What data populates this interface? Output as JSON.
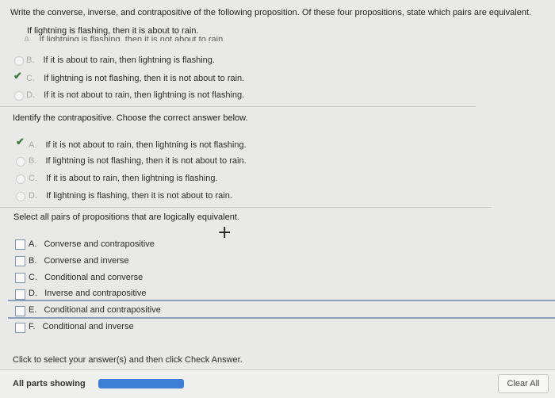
{
  "question": "Write the converse, inverse, and contrapositive of the following proposition. Of these four propositions, state which pairs are equivalent.",
  "proposition": "If lightning is flashing, then it is about to rain.",
  "part1": {
    "cut_option": {
      "letter": "A.",
      "text": "If lightning is flashing, then it is not about to rain."
    },
    "options": [
      {
        "letter": "B.",
        "text": "If it is about to rain, then lightning is flashing."
      },
      {
        "letter": "C.",
        "text": "If lightning is not flashing, then it is not about to rain."
      },
      {
        "letter": "D.",
        "text": "If it is not about to rain, then lightning is not flashing."
      }
    ],
    "selected": "C"
  },
  "part2": {
    "prompt": "Identify the contrapositive. Choose the correct answer below.",
    "options": [
      {
        "letter": "A.",
        "text": "If it is not about to rain, then lightning is not flashing."
      },
      {
        "letter": "B.",
        "text": "If lightning is not flashing, then it is not about to rain."
      },
      {
        "letter": "C.",
        "text": "If it is about to rain, then lightning is flashing."
      },
      {
        "letter": "D.",
        "text": "If lightning is flashing, then it is not about to rain."
      }
    ],
    "selected": "A"
  },
  "part3": {
    "prompt": "Select all pairs of propositions that are logically equivalent.",
    "options": [
      {
        "letter": "A.",
        "text": "Converse and contrapositive"
      },
      {
        "letter": "B.",
        "text": "Converse and inverse"
      },
      {
        "letter": "C.",
        "text": "Conditional and converse"
      },
      {
        "letter": "D.",
        "text": "Inverse and contrapositive"
      },
      {
        "letter": "E.",
        "text": "Conditional and contrapositive"
      },
      {
        "letter": "F.",
        "text": "Conditional and inverse"
      }
    ]
  },
  "footer": {
    "instruction": "Click to select your answer(s) and then click Check Answer.",
    "parts_label": "All parts showing",
    "clear_label": "Clear All",
    "accent_color": "#3d7fd6"
  },
  "icons": {
    "check": "checkmark-icon",
    "cursor": "crosshair-cursor-icon"
  }
}
